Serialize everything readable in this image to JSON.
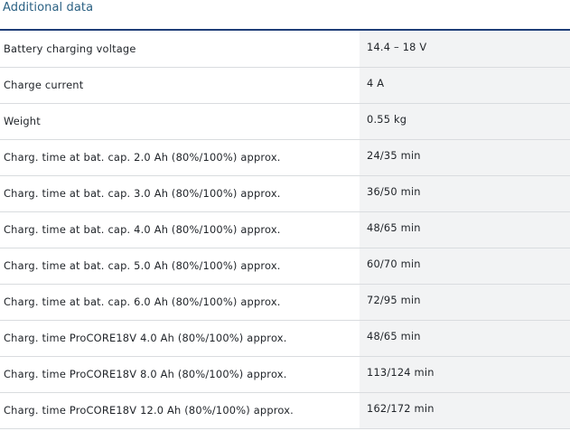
{
  "section": {
    "title": "Additional data"
  },
  "rows": [
    {
      "label": "Battery charging voltage",
      "value": "14.4 – 18 V"
    },
    {
      "label": "Charge current",
      "value": "4 A"
    },
    {
      "label": "Weight",
      "value": "0.55 kg"
    },
    {
      "label": "Charg. time at bat. cap. 2.0 Ah (80%/100%) approx.",
      "value": "24/35 min"
    },
    {
      "label": "Charg. time at bat. cap. 3.0 Ah (80%/100%) approx.",
      "value": "36/50 min"
    },
    {
      "label": "Charg. time at bat. cap. 4.0 Ah (80%/100%) approx.",
      "value": "48/65 min"
    },
    {
      "label": "Charg. time at bat. cap. 5.0 Ah (80%/100%) approx.",
      "value": "60/70 min"
    },
    {
      "label": "Charg. time at bat. cap. 6.0 Ah (80%/100%) approx.",
      "value": "72/95 min"
    },
    {
      "label": "Charg. time ProCORE18V 4.0 Ah (80%/100%) approx.",
      "value": "48/65 min"
    },
    {
      "label": "Charg. time ProCORE18V 8.0 Ah (80%/100%) approx.",
      "value": "113/124 min"
    },
    {
      "label": "Charg. time ProCORE18V 12.0 Ah (80%/100%) approx.",
      "value": "162/172 min"
    }
  ],
  "colors": {
    "title_text": "#2b6183",
    "title_rule": "#1e3e78",
    "value_cell_bg": "#f2f3f4",
    "row_divider": "#d9dcdf"
  }
}
